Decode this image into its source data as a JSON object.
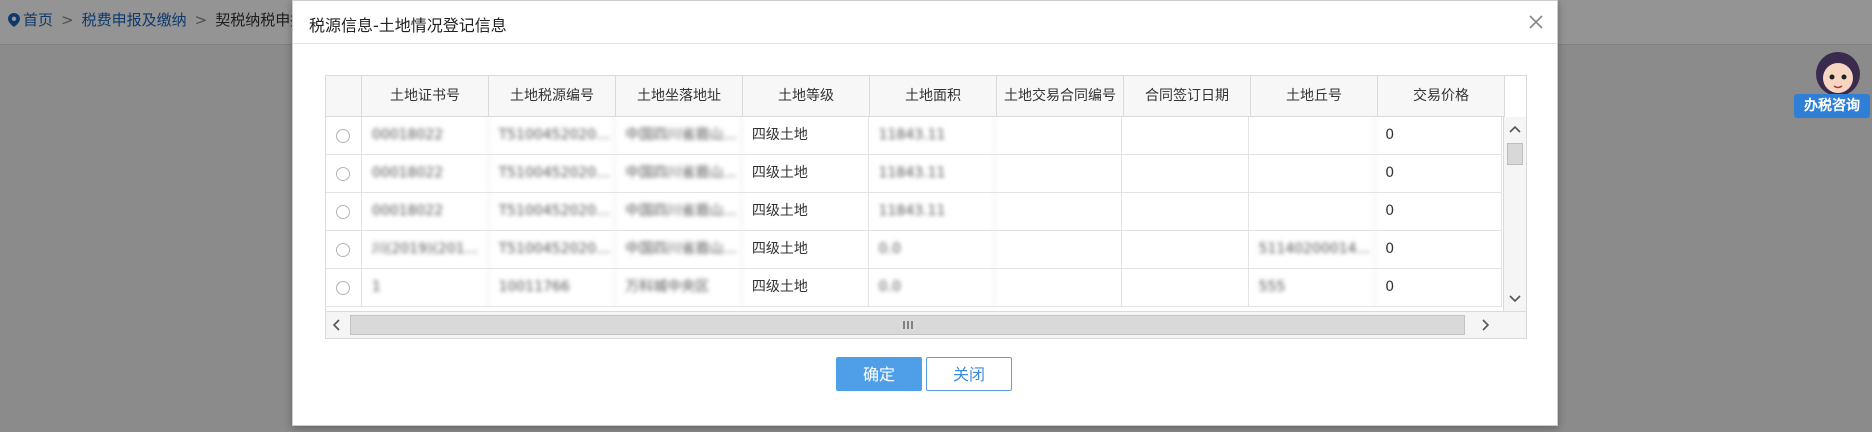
{
  "background": {
    "breadcrumb": [
      "首页",
      "税费申报及缴纳",
      "契税纳税申报"
    ],
    "assistant_label": "办税咨询"
  },
  "dialog": {
    "title": "税源信息-土地情况登记信息",
    "buttons": {
      "ok": "确定",
      "close": "关闭"
    }
  },
  "table": {
    "columns": [
      "土地证书号",
      "土地税源编号",
      "土地坐落地址",
      "土地等级",
      "土地面积",
      "土地交易合同编号",
      "合同签订日期",
      "土地丘号",
      "交易价格"
    ],
    "rows": [
      [
        "00018022",
        "T51004520201...",
        "中国四川省眉山...",
        "四级土地",
        "11843.11",
        "",
        "",
        "",
        "0"
      ],
      [
        "00018022",
        "T51004520201...",
        "中国四川省眉山...",
        "四级土地",
        "11843.11",
        "",
        "",
        "",
        "0"
      ],
      [
        "00018022",
        "T51004520201...",
        "中国四川省眉山...",
        "四级土地",
        "11843.11",
        "",
        "",
        "",
        "0"
      ],
      [
        "川(2019)(201...",
        "T51004520201...",
        "中国四川省眉山...",
        "四级土地",
        "0.0",
        "",
        "",
        "51140200014...",
        "0"
      ],
      [
        "1",
        "10011766",
        "万科城中央区",
        "四级土地",
        "0.0",
        "",
        "",
        "555",
        "0"
      ]
    ],
    "blurred_columns": [
      0,
      1,
      2,
      4,
      7
    ]
  },
  "colors": {
    "primary": "#4f9fe8",
    "link": "#1a62b8",
    "assistant": "#2f7fd6"
  }
}
